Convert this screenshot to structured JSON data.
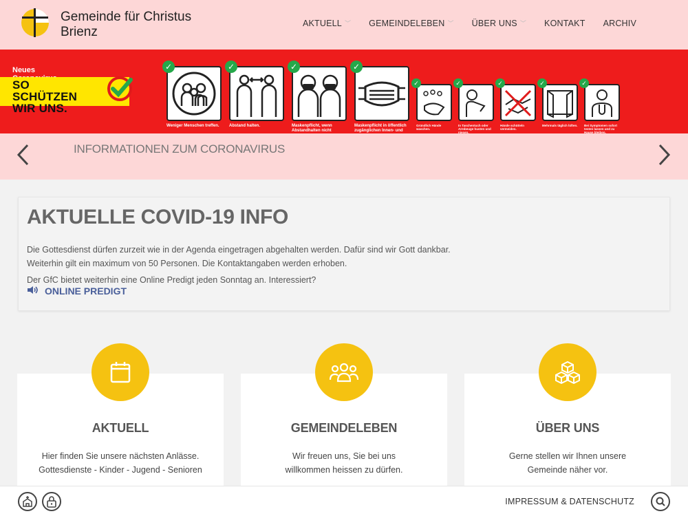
{
  "header": {
    "logo_line1": "Gemeinde für Christus",
    "logo_line2": "Brienz",
    "nav": [
      {
        "label": "AKTUELL",
        "has_dropdown": true
      },
      {
        "label": "GEMEINDELEBEN",
        "has_dropdown": true
      },
      {
        "label": "ÜBER UNS",
        "has_dropdown": true
      },
      {
        "label": "KONTAKT",
        "has_dropdown": false
      },
      {
        "label": "ARCHIV",
        "has_dropdown": false
      }
    ]
  },
  "banner": {
    "small": "Neues Coronavirus",
    "big_line1": "SO SCHÜTZEN",
    "big_line2": "WIR UNS.",
    "captions": [
      "Weniger Menschen treffen.",
      "Abstand halten.",
      "Maskenpflicht, wenn Abstandhalten nicht möglich ist.",
      "Maskenpflicht in öffentlich zugänglichen Innen- und Aussenbereichen und im öffentlichen Verkehr.",
      "Gründlich Hände waschen.",
      "In Taschentuch oder Armbeuge husten und niesen.",
      "Hände schütteln vermeiden.",
      "Mehrmals täglich lüften.",
      "Bei Symptomen sofort testen lassen und zu Hause bleiben."
    ]
  },
  "slider": {
    "title": "INFORMATIONEN ZUM CORONAVIRUS",
    "prev": "‹",
    "next": "›"
  },
  "covid": {
    "title": "AKTUELLE COVID-19 INFO",
    "line1": "Die Gottesdienst dürfen zurzeit wie in der Agenda eingetragen abgehalten werden. Dafür sind wir Gott dankbar.",
    "line2": "Weiterhin gilt ein maximum von 50 Personen. Die Kontaktangaben werden erhoben.",
    "line3": "Der GfC bietet weiterhin eine Online Predigt jeden Sonntag an. Interessiert?",
    "online_label": "ONLINE PREDIGT"
  },
  "cards": [
    {
      "title": "AKTUELL",
      "text1": "Hier finden Sie unsere nächsten Anlässe.",
      "text2": "Gottesdienste - Kinder - Jugend - Senioren",
      "icon": "calendar-icon"
    },
    {
      "title": "GEMEINDELEBEN",
      "text1": "Wir freuen uns, Sie bei uns",
      "text2": "willkommen heissen zu dürfen.",
      "icon": "users-icon"
    },
    {
      "title": "ÜBER UNS",
      "text1": "Gerne stellen wir Ihnen unsere",
      "text2": "Gemeinde näher vor.",
      "icon": "cubes-icon"
    }
  ],
  "footer": {
    "impressum": "IMPRESSUM & DATENSCHUTZ"
  },
  "colors": {
    "header_bg": "#fdd7d7",
    "banner_red": "#ee1c1c",
    "accent_yellow": "#f5c211",
    "link_blue": "#4a5f9a",
    "check_green": "#25a84a"
  }
}
